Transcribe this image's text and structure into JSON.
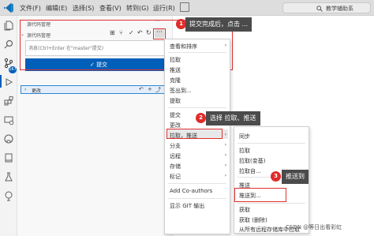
{
  "titlebar": {
    "menus": [
      "文件(F)",
      "编辑(E)",
      "选择(S)",
      "查看(V)",
      "转到(G)",
      "运行(R)"
    ],
    "search_text": "教学辅助系"
  },
  "activitybar": {
    "icons": [
      "explorer-icon",
      "search-icon",
      "source-control-icon",
      "run-debug-icon",
      "extensions-icon",
      "remote-icon",
      "github-icon",
      "book-icon",
      "test-icon",
      "docker-icon"
    ],
    "scm_badge": "167"
  },
  "scm": {
    "title": "源代码管理",
    "repo_label": "源代码管理",
    "commit_placeholder": "消息(Ctrl+Enter 在\"master\"提交)",
    "commit_label": "✓ 提交",
    "changes_label": "更改",
    "changes_count": "167"
  },
  "more_menu": {
    "items": [
      "查看和排序",
      "拉取",
      "推送",
      "克隆",
      "签出到...",
      "提取",
      "提交",
      "更改",
      "拉取，推送",
      "分支",
      "远程",
      "存储",
      "标记",
      "Add Co-authors",
      "显示 GIT 输出"
    ],
    "has_submenu": [
      true,
      false,
      false,
      false,
      false,
      false,
      true,
      true,
      true,
      true,
      true,
      true,
      true,
      false,
      false
    ]
  },
  "pull_push_submenu": {
    "items": [
      "同步",
      "拉取",
      "拉取(变基)",
      "拉取自...",
      "推送",
      "推送到...",
      "获取",
      "获取 (删除)",
      "从所有远程存储库中拉取"
    ]
  },
  "callouts": [
    {
      "number": "1",
      "text": "提交完成后，点击 ..."
    },
    {
      "number": "2",
      "text": "选择 拉取、推送"
    },
    {
      "number": "3",
      "text": "推送到"
    }
  ],
  "watermark": "CSDN @等日出看彩虹",
  "colors": {
    "accent": "#005fb8",
    "callout_bg": "#4b4b4b",
    "highlight_red": "#e03030",
    "badge_red": "#e02b2b"
  }
}
